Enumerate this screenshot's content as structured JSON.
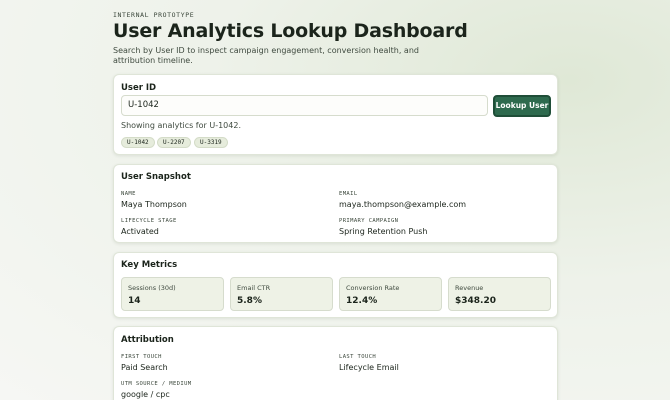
{
  "header": {
    "eyebrow": "INTERNAL PROTOTYPE",
    "title": "User Analytics Lookup Dashboard",
    "subtitle": "Search by User ID to inspect campaign engagement, conversion health, and attribution timeline."
  },
  "lookup": {
    "section_title": "User ID",
    "input_value": "U-1042",
    "button_label": "Lookup User",
    "status": "Showing analytics for U-1042.",
    "chips": [
      "U-1042",
      "U-2207",
      "U-3319"
    ]
  },
  "snapshot": {
    "section_title": "User Snapshot",
    "fields": [
      {
        "label": "NAME",
        "value": "Maya Thompson"
      },
      {
        "label": "EMAIL",
        "value": "maya.thompson@example.com"
      },
      {
        "label": "LIFECYCLE STAGE",
        "value": "Activated"
      },
      {
        "label": "PRIMARY CAMPAIGN",
        "value": "Spring Retention Push"
      }
    ]
  },
  "metrics": {
    "section_title": "Key Metrics",
    "items": [
      {
        "label": "Sessions (30d)",
        "value": "14"
      },
      {
        "label": "Email CTR",
        "value": "5.8%"
      },
      {
        "label": "Conversion Rate",
        "value": "12.4%"
      },
      {
        "label": "Revenue",
        "value": "$348.20"
      }
    ]
  },
  "attribution": {
    "section_title": "Attribution",
    "fields": [
      {
        "label": "FIRST TOUCH",
        "value": "Paid Search"
      },
      {
        "label": "LAST TOUCH",
        "value": "Lifecycle Email"
      },
      {
        "label": "UTM SOURCE / MEDIUM",
        "value": "google / cpc"
      }
    ]
  },
  "colors": {
    "accent": "#2e6a4e",
    "metric_bg": "#eef2e6",
    "chip_bg": "#e6ecdc"
  }
}
